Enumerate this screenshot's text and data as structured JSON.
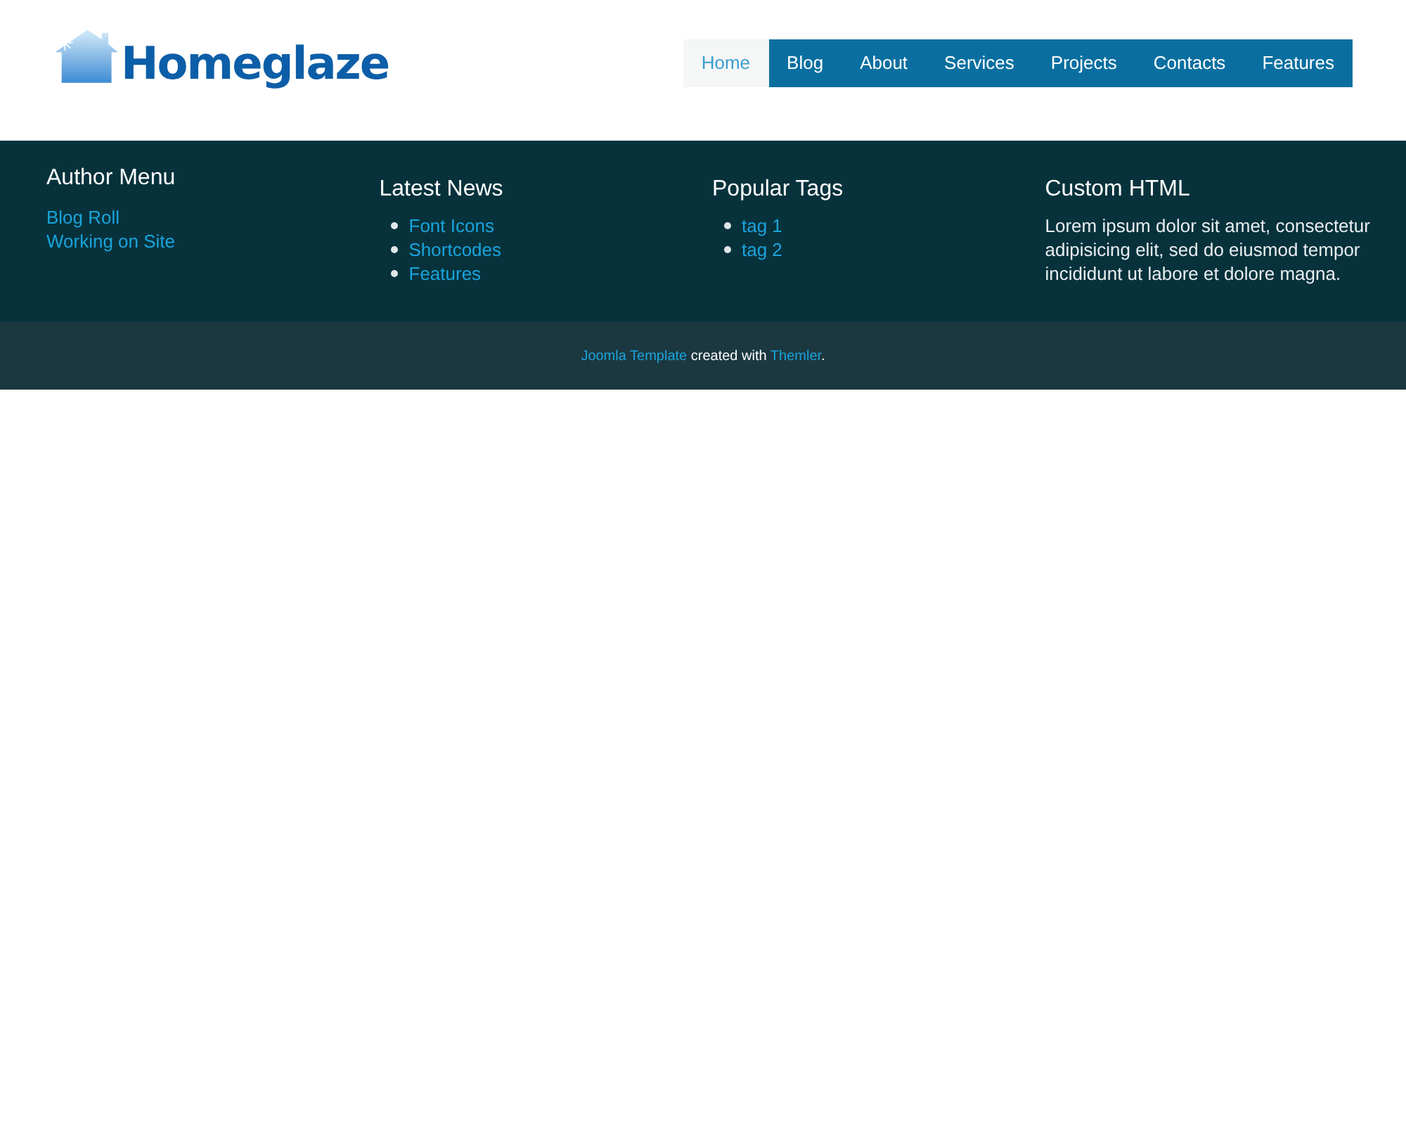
{
  "logo": {
    "text": "Homeglaze"
  },
  "nav": [
    {
      "label": "Home",
      "selected": true
    },
    {
      "label": "Blog",
      "selected": false
    },
    {
      "label": "About",
      "selected": false
    },
    {
      "label": "Services",
      "selected": false
    },
    {
      "label": "Projects",
      "selected": false
    },
    {
      "label": "Contacts",
      "selected": false
    },
    {
      "label": "Features",
      "selected": false
    }
  ],
  "footer_columns": [
    {
      "kind": "menu",
      "title": "Author Menu",
      "items": [
        "Blog Roll",
        "Working on Site"
      ]
    },
    {
      "kind": "list",
      "title": "Latest News",
      "items": [
        "Font Icons",
        "Shortcodes",
        "Features"
      ]
    },
    {
      "kind": "list",
      "title": "Popular Tags",
      "items": [
        "tag 1",
        "tag 2"
      ]
    },
    {
      "kind": "text",
      "title": "Custom HTML",
      "text": "Lorem ipsum dolor sit amet, consectetur adipisicing elit, sed do eiusmod tempor incididunt ut labore et dolore magna."
    }
  ],
  "credit": [
    {
      "kind": "link",
      "text": "Joomla Template"
    },
    {
      "kind": "text",
      "text": " created with "
    },
    {
      "kind": "link",
      "text": "Themler"
    },
    {
      "kind": "text",
      "text": "."
    }
  ]
}
